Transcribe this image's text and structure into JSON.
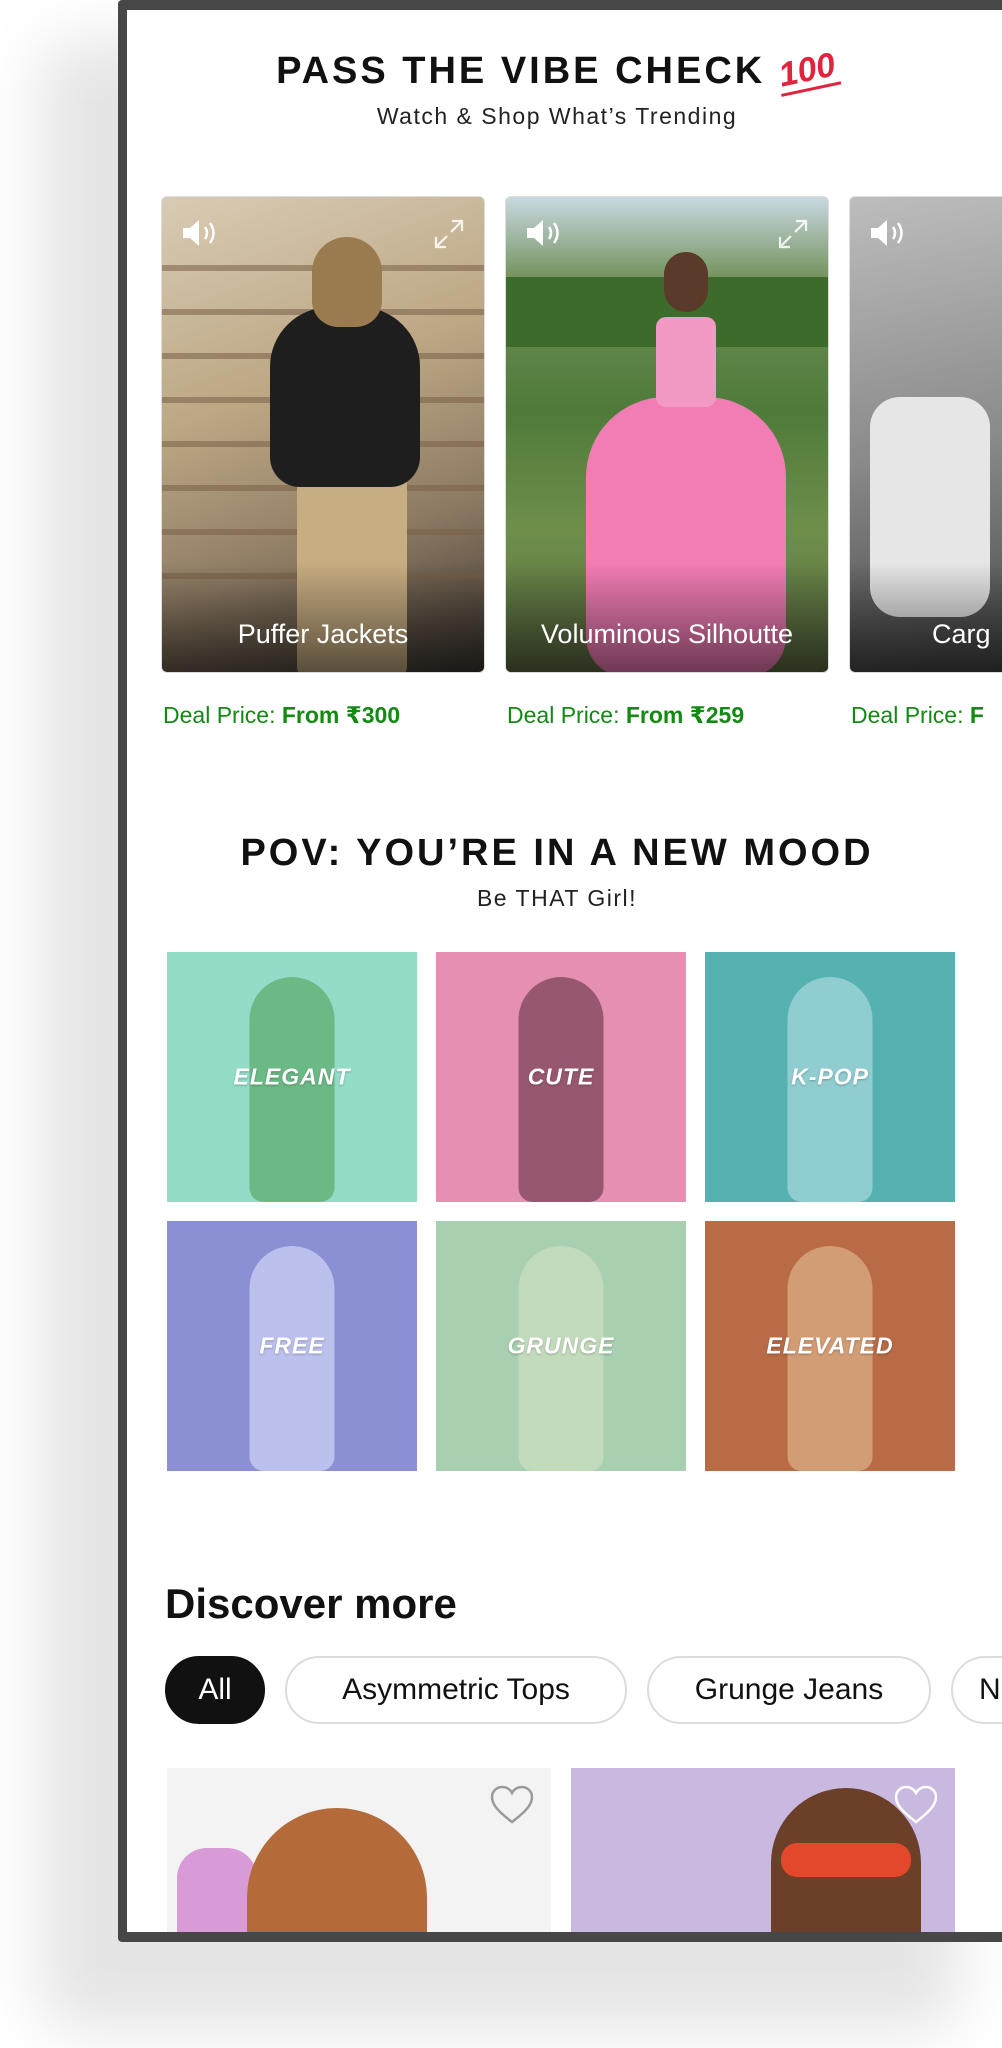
{
  "section1": {
    "title": "PASS THE VIBE CHECK",
    "emoji": "💯",
    "subtitle": "Watch & Shop What’s Trending",
    "cards": [
      {
        "label": "Puffer Jackets",
        "deal_prefix": "Deal Price: ",
        "deal_value": "From ₹300"
      },
      {
        "label": "Voluminous Silhoutte",
        "deal_prefix": "Deal Price: ",
        "deal_value": "From ₹259"
      },
      {
        "label": "Carg",
        "deal_prefix": "Deal Price: ",
        "deal_value": "F"
      }
    ]
  },
  "section2": {
    "title": "POV: YOU’RE IN A NEW MOOD",
    "subtitle": "Be THAT Girl!",
    "moods": [
      "ELEGANT",
      "CUTE",
      "K-POP",
      "FREE",
      "GRUNGE",
      "ELEVATED"
    ]
  },
  "section3": {
    "title": "Discover more",
    "chips": [
      "All",
      "Asymmetric Tops",
      "Grunge Jeans",
      "N"
    ]
  },
  "colors": {
    "deal_green": "#148a14",
    "chip_active_bg": "#111111",
    "emoji_red": "#e1243d"
  },
  "icons": [
    "speaker-icon",
    "expand-icon",
    "heart-icon"
  ]
}
